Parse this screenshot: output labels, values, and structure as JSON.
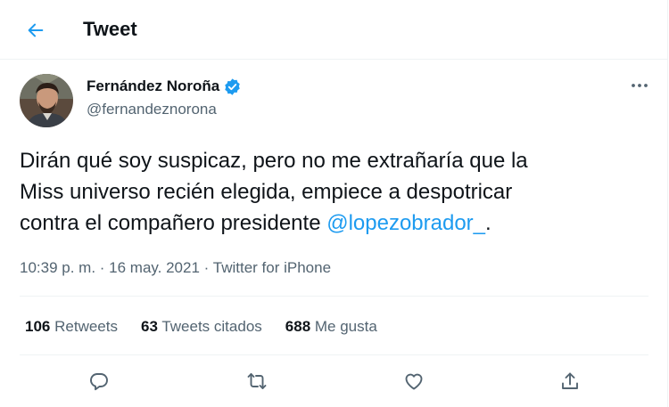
{
  "header": {
    "title": "Tweet"
  },
  "author": {
    "name": "Fernández Noroña",
    "handle": "@fernandeznorona"
  },
  "tweet": {
    "line1": "Dirán qué soy suspicaz, pero no me extrañaría que la",
    "line2": "Miss universo recién elegida, empiece a despotricar",
    "line3_text": "contra el compañero presidente ",
    "mention": "@lopezobrador_",
    "line3_end": "."
  },
  "meta": {
    "time": "10:39 p. m.",
    "separator1": " · ",
    "date": "16 may. 2021",
    "separator2": " · ",
    "source": "Twitter for iPhone"
  },
  "stats": {
    "retweets_count": "106",
    "retweets_label": "Retweets",
    "quotes_count": "63",
    "quotes_label": "Tweets citados",
    "likes_count": "688",
    "likes_label": "Me gusta"
  },
  "colors": {
    "accent": "#1d9bf0",
    "text": "#0f1419",
    "secondary": "#536471",
    "border": "#eff3f4"
  },
  "icons": {
    "back": "arrow-left-icon",
    "verified": "verified-badge-icon",
    "more": "more-dots-icon",
    "reply": "reply-icon",
    "retweet": "retweet-icon",
    "like": "heart-icon",
    "share": "share-icon"
  }
}
